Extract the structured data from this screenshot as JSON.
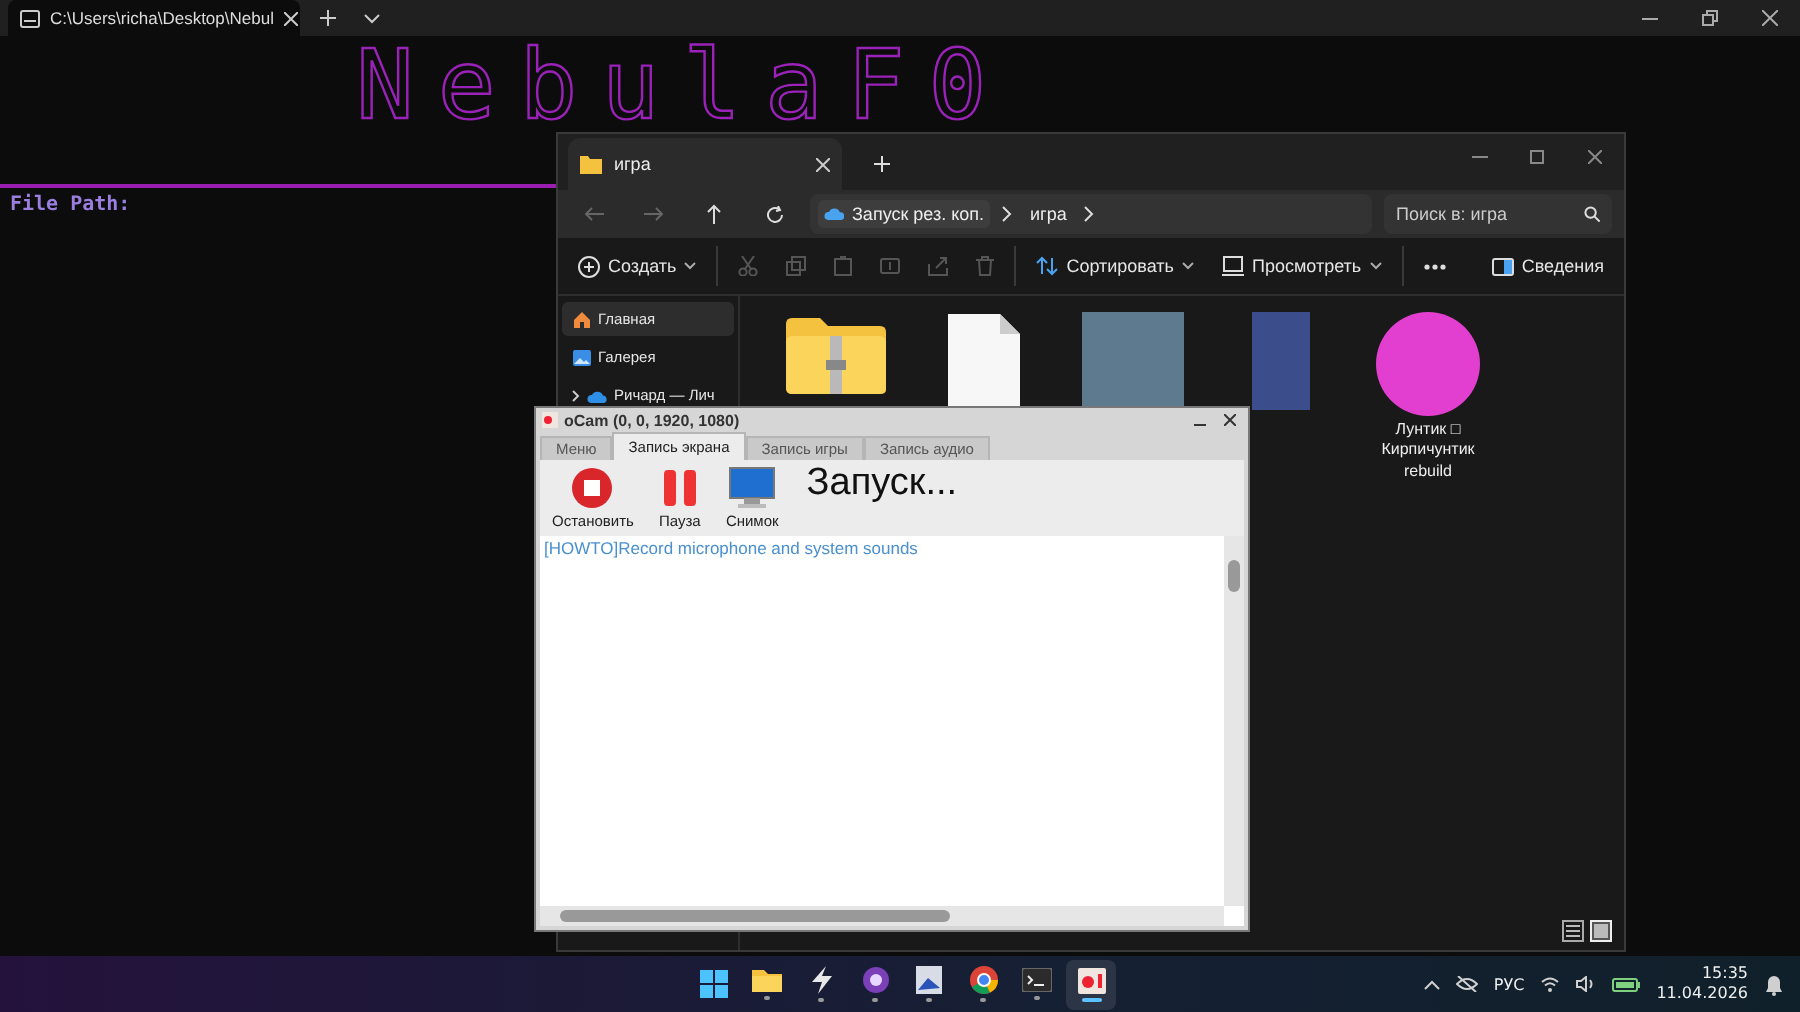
{
  "terminal": {
    "tab_title": "C:\\Users\\richa\\Desktop\\Nebul",
    "banner": "NebulaF0",
    "prompt": "File Path:"
  },
  "explorer": {
    "tab_title": "игра",
    "breadcrumb": [
      {
        "label": "Запуск рез. коп."
      },
      {
        "label": "игра"
      }
    ],
    "search": {
      "placeholder": "Поиск в: игра"
    },
    "toolbar": {
      "create": "Создать",
      "sort": "Сортировать",
      "view": "Просмотреть",
      "details": "Сведения"
    },
    "sidebar": {
      "items": [
        {
          "kind": "home",
          "label": "Главная",
          "selected": true
        },
        {
          "kind": "gallery",
          "label": "Галерея",
          "selected": false
        },
        {
          "kind": "cloud",
          "label": "Ричард — Лич",
          "selected": false
        }
      ]
    },
    "files": [
      {
        "kind": "zip-folder"
      },
      {
        "kind": "document"
      },
      {
        "kind": "photo"
      },
      {
        "kind": "tall-photo"
      },
      {
        "kind": "round-photo",
        "name": "Лунтик □ Кирпичунтик rebuild"
      }
    ],
    "view_modes": [
      {
        "kind": "details",
        "selected": false
      },
      {
        "kind": "tiles",
        "selected": true
      }
    ]
  },
  "ocam": {
    "title": "oCam (0, 0, 1920, 1080)",
    "tabs": [
      {
        "label": "Меню",
        "selected": false
      },
      {
        "label": "Запись экрана",
        "selected": true
      },
      {
        "label": "Запись игры",
        "selected": false
      },
      {
        "label": "Запись аудио",
        "selected": false
      }
    ],
    "actions": [
      {
        "kind": "stop",
        "label": "Остановить"
      },
      {
        "kind": "pause",
        "label": "Пауза"
      },
      {
        "kind": "snapshot",
        "label": "Снимок"
      }
    ],
    "status": "Запуск...",
    "link": "[HOWTO]Record microphone and system sounds"
  },
  "taskbar": {
    "apps": [
      {
        "kind": "start",
        "selected": false
      },
      {
        "kind": "folder",
        "selected": false
      },
      {
        "kind": "bolt",
        "selected": false
      },
      {
        "kind": "purple-app",
        "selected": false
      },
      {
        "kind": "image-app",
        "selected": false
      },
      {
        "kind": "chrome",
        "selected": false
      },
      {
        "kind": "terminal",
        "selected": false
      },
      {
        "kind": "recorder",
        "selected": true
      }
    ],
    "language": "РУС",
    "time": "15:35",
    "date": "11.04.2026"
  }
}
